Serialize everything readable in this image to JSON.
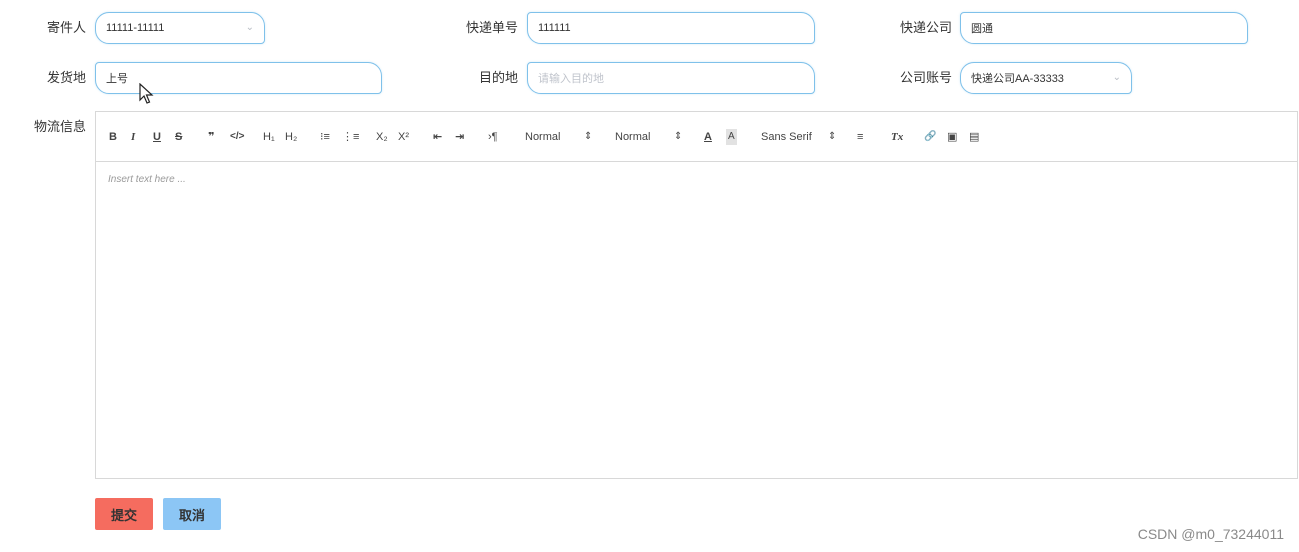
{
  "form": {
    "sender": {
      "label": "寄件人",
      "value": "11111-11111"
    },
    "tracking_no": {
      "label": "快递单号",
      "value": "111111"
    },
    "courier": {
      "label": "快递公司",
      "value": "圆通"
    },
    "origin": {
      "label": "发货地",
      "value": "上号"
    },
    "destination": {
      "label": "目的地",
      "placeholder": "请输入目的地"
    },
    "account": {
      "label": "公司账号",
      "value": "快递公司AA-33333"
    },
    "logistics": {
      "label": "物流信息"
    }
  },
  "editor": {
    "toolbar": {
      "bold": "B",
      "italic": "I",
      "underline": "U",
      "strike": "S",
      "blockquote": "❞",
      "code": "</>",
      "h1": "H₁",
      "h2": "H₂",
      "ordered_list": "⁝≡",
      "bullet_list": "⋮≡",
      "subscript": "X₂",
      "superscript": "X²",
      "outdent": "⇤",
      "indent": "⇥",
      "direction": "›¶",
      "header_select": "Normal",
      "size_select": "Normal",
      "select_arrow": "⇕",
      "color": "A",
      "background": "A",
      "font_select": "Sans Serif",
      "align": "≡",
      "clean": "Tx",
      "link": "🔗",
      "image": "▣",
      "video": "▤"
    },
    "placeholder": "Insert text here ..."
  },
  "buttons": {
    "submit": "提交",
    "cancel": "取消"
  },
  "colors": {
    "field_border": "#7fc1ea",
    "submit_bg": "#f56c5f",
    "cancel_bg": "#8cc6f5"
  },
  "watermark": "CSDN @m0_73244011"
}
